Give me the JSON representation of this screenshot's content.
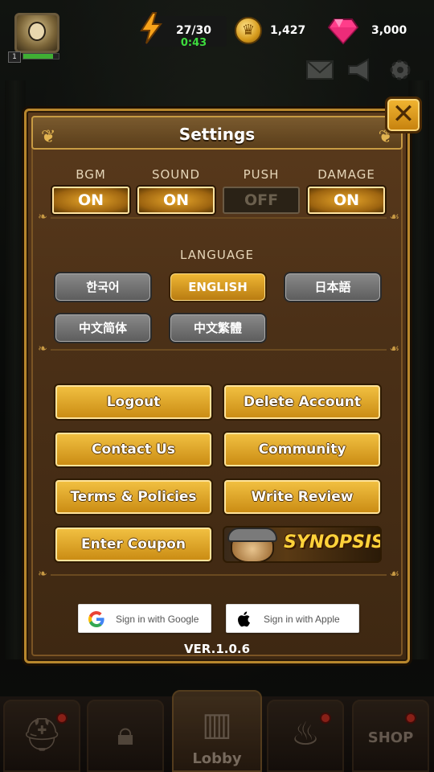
{
  "hud": {
    "level": "1",
    "energy": "27/30",
    "energy_timer": "0:43",
    "coins": "1,427",
    "gems": "3,000"
  },
  "settings": {
    "title": "Settings",
    "close_icon": "close-x-icon",
    "toggles": [
      {
        "label": "BGM",
        "state": "ON"
      },
      {
        "label": "SOUND",
        "state": "ON"
      },
      {
        "label": "PUSH",
        "state": "OFF"
      },
      {
        "label": "DAMAGE",
        "state": "ON"
      }
    ],
    "language_title": "LANGUAGE",
    "languages": [
      {
        "label": "한국어",
        "selected": false
      },
      {
        "label": "ENGLISH",
        "selected": true
      },
      {
        "label": "日本語",
        "selected": false
      },
      {
        "label": "中文简体",
        "selected": false
      },
      {
        "label": "中文繁體",
        "selected": false
      }
    ],
    "buttons": {
      "logout": "Logout",
      "delete_account": "Delete Account",
      "contact_us": "Contact Us",
      "community": "Community",
      "terms": "Terms & Policies",
      "write_review": "Write Review",
      "enter_coupon": "Enter Coupon",
      "synopsis": "SYNOPSIS"
    },
    "sign_in": {
      "google": "Sign in with Google",
      "apple": "Sign in with Apple"
    },
    "version": "VER.1.0.6"
  },
  "nav": {
    "lobby_label": "Lobby",
    "shop_label": "SHOP"
  },
  "colors": {
    "gold_button": "#e0a82a",
    "panel_brown": "#4b3017",
    "energy_timer_green": "#3ddc3d",
    "gem_pink": "#ff3d8a"
  }
}
